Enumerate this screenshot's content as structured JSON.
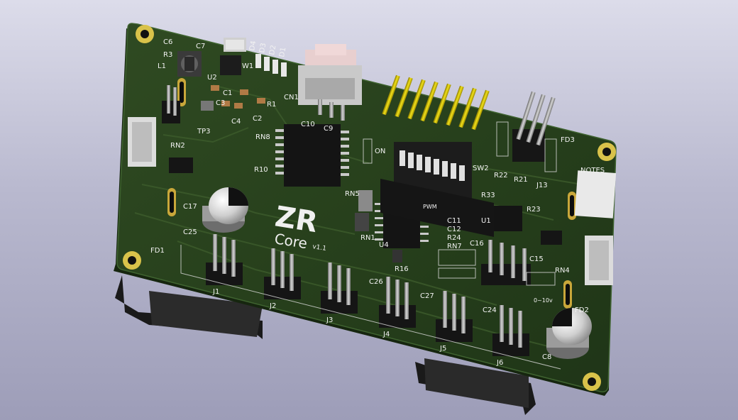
{
  "board": {
    "logo": "ZR",
    "name": "Core",
    "version": "v1.1",
    "notes_label": "NOTES"
  },
  "labels": {
    "c6": "C6",
    "c7": "C7",
    "r3": "R3",
    "l1": "L1",
    "c1": "C1",
    "c3": "C3",
    "c4": "C4",
    "c2": "C2",
    "r1": "R1",
    "u2": "U2",
    "tp3": "TP3",
    "w1": "W1",
    "cn1": "CN1",
    "d4": "D4",
    "d3": "D3",
    "d2": "D2",
    "d1": "D1",
    "c10": "C10",
    "c9": "C9",
    "rn8": "RN8",
    "r10": "R10",
    "rn2": "RN2",
    "rn5": "RN5",
    "sw2": "SW2",
    "on": "ON",
    "dip_on": "ON",
    "fd1": "FD1",
    "fd2": "FD2",
    "fd3": "FD3",
    "r22": "R22",
    "r21": "R21",
    "j13": "J13",
    "r33": "R33",
    "r23": "R23",
    "u1": "U1",
    "c16": "C16",
    "c15": "C15",
    "rn4": "RN4",
    "c17": "C17",
    "c25": "C25",
    "c8": "C8",
    "rn1": "RN1",
    "u4": "U4",
    "r16": "R16",
    "c11": "C11",
    "c12": "C12",
    "r24": "R24",
    "rn7": "RN7",
    "c27": "C27",
    "c26": "C26",
    "c24": "C24",
    "j1": "J1",
    "j2": "J2",
    "j3": "J3",
    "j4": "J4",
    "j5": "J5",
    "j6": "J6",
    "pwm": "PWM",
    "lv_note": "0~10v"
  }
}
